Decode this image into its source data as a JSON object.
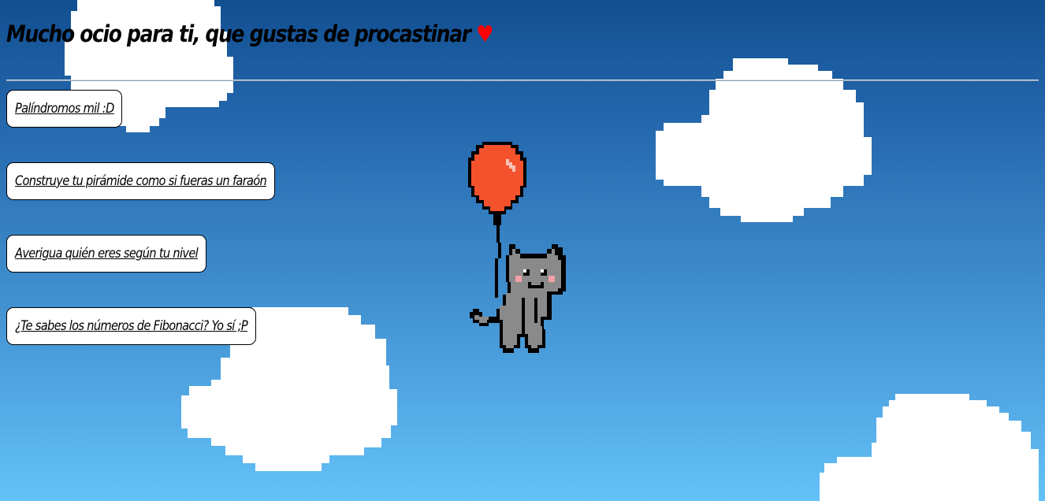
{
  "header": {
    "title": "Mucho ocio para ti, que gustas de procastinar",
    "heart": "♥"
  },
  "links": [
    {
      "label": "Palíndromos mil :D"
    },
    {
      "label": "Construye tu pirámide como si fueras un faraón"
    },
    {
      "label": "Averigua quién eres según tu nivel"
    },
    {
      "label": "¿Te sabes los números de Fibonacci? Yo sí ;P"
    }
  ],
  "colors": {
    "sky_top": "#124f91",
    "sky_bottom": "#64c2f8",
    "cloud": "#ffffff",
    "heart": "#ff0000",
    "balloon": "#f4522c",
    "cat": "#8a8a8a",
    "blush": "#f5a0a8"
  },
  "icons": {
    "balloon_cat": "balloon-cat-illustration",
    "heart": "heart-icon"
  }
}
